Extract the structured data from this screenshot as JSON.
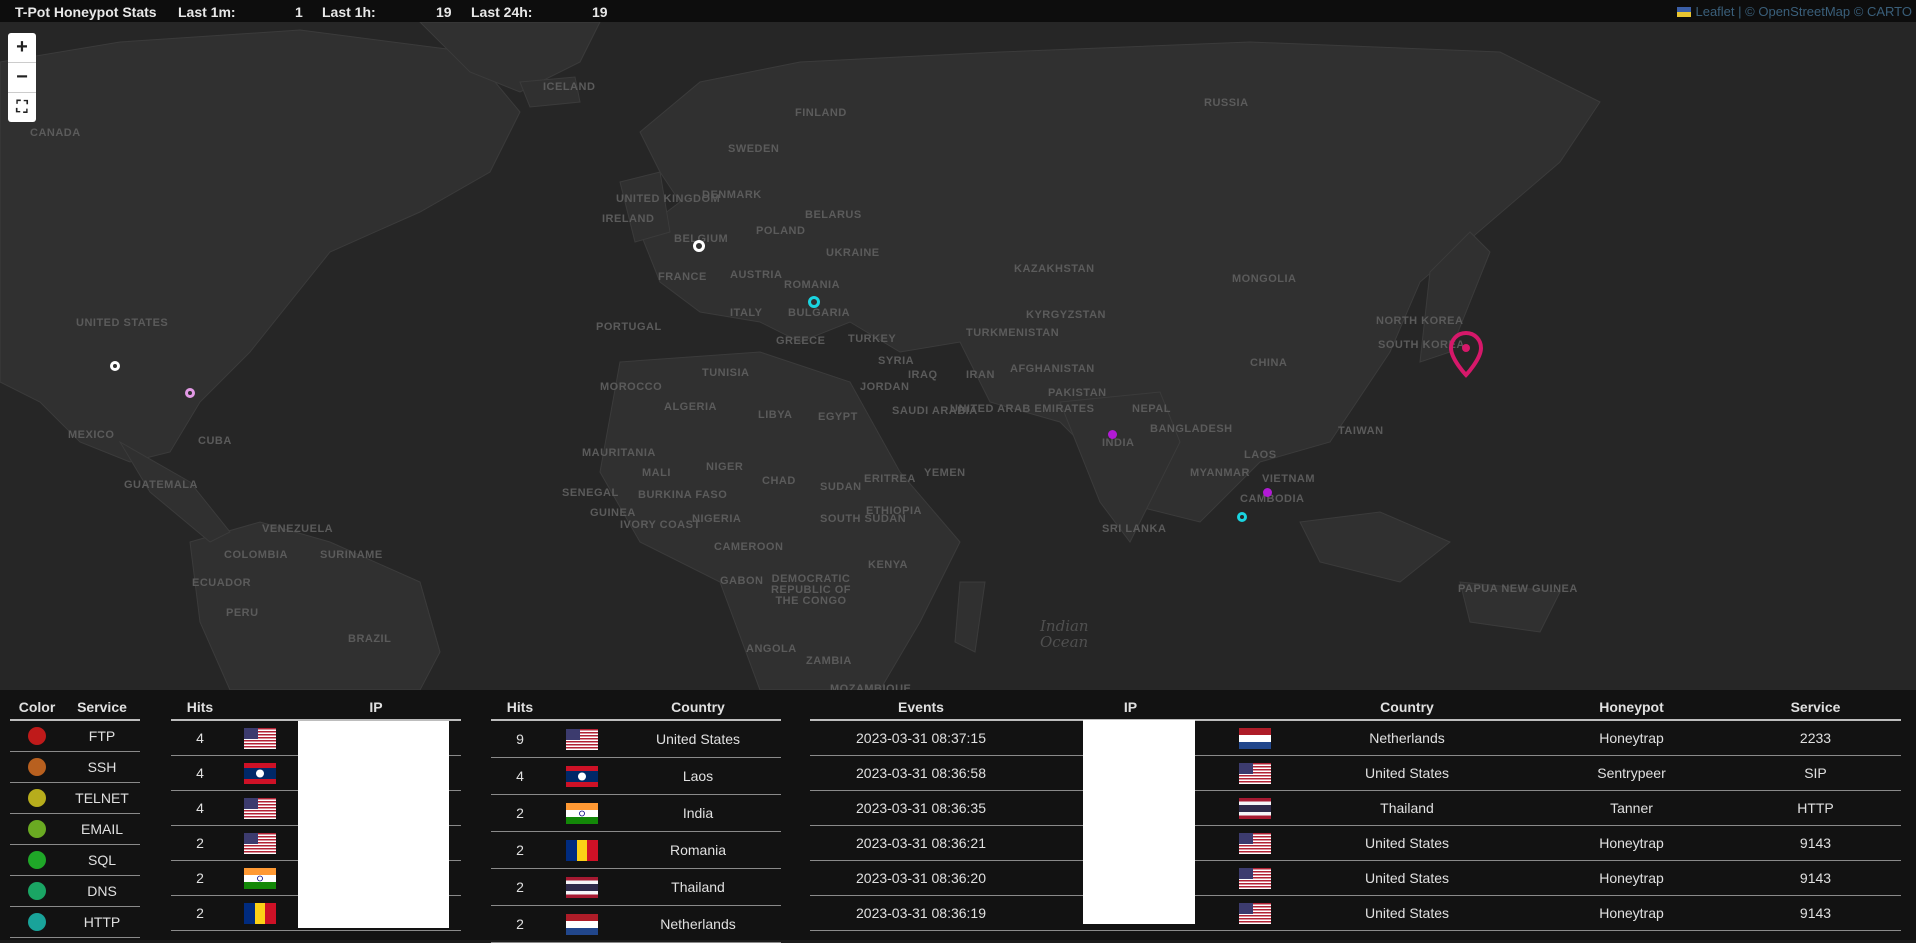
{
  "topbar": {
    "title": "T-Pot Honeypot Stats",
    "last_1m_label": "Last 1m:",
    "last_1m": "1",
    "last_1h_label": "Last 1h:",
    "last_1h": "19",
    "last_24h_label": "Last 24h:",
    "last_24h": "19"
  },
  "attribution": {
    "leaflet": "Leaflet",
    "sep": "|",
    "osm": "© OpenStreetMap",
    "carto": "© CARTO"
  },
  "map_controls": {
    "zoom_in": "+",
    "zoom_out": "−",
    "fullscreen": "⛶"
  },
  "map_labels": [
    "CANADA",
    "UNITED STATES",
    "MEXICO",
    "CUBA",
    "GUATEMALA",
    "VENEZUELA",
    "COLOMBIA",
    "SURINAME",
    "ECUADOR",
    "PERU",
    "BRAZIL",
    "ICELAND",
    "FINLAND",
    "SWEDEN",
    "UNITED KINGDOM",
    "IRELAND",
    "DENMARK",
    "BELGIUM",
    "POLAND",
    "BELARUS",
    "UKRAINE",
    "FRANCE",
    "AUSTRIA",
    "ROMANIA",
    "ITALY",
    "BULGARIA",
    "GREECE",
    "PORTUGAL",
    "TURKEY",
    "RUSSIA",
    "KAZAKHSTAN",
    "MONGOLIA",
    "KYRGYZSTAN",
    "TURKMENISTAN",
    "AFGHANISTAN",
    "IRAN",
    "IRAQ",
    "SYRIA",
    "JORDAN",
    "SAUDI ARABIA",
    "UNITED ARAB EMIRATES",
    "YEMEN",
    "PAKISTAN",
    "NEPAL",
    "INDIA",
    "BANGLADESH",
    "CHINA",
    "NORTH KOREA",
    "SOUTH KOREA",
    "TAIWAN",
    "MYANMAR",
    "LAOS",
    "VIETNAM",
    "CAMBODIA",
    "SRI LANKA",
    "PAPUA NEW GUINEA",
    "MOROCCO",
    "ALGERIA",
    "LIBYA",
    "EGYPT",
    "TUNISIA",
    "MAURITANIA",
    "MALI",
    "NIGER",
    "CHAD",
    "SUDAN",
    "SOUTH SUDAN",
    "ERITREA",
    "ETHIOPIA",
    "KENYA",
    "SENEGAL",
    "GUINEA",
    "BURKINA FASO",
    "IVORY COAST",
    "NIGERIA",
    "CAMEROON",
    "GABON",
    "DEMOCRATIC REPUBLIC OF THE CONGO",
    "ANGOLA",
    "ZAMBIA",
    "MOZAMBIQUE",
    "Indian Ocean"
  ],
  "services_legend": {
    "headers": [
      "Color",
      "Service"
    ],
    "rows": [
      {
        "color": "#bf1a1a",
        "service": "FTP"
      },
      {
        "color": "#b8601f",
        "service": "SSH"
      },
      {
        "color": "#b7ad1c",
        "service": "TELNET"
      },
      {
        "color": "#6aaa22",
        "service": "EMAIL"
      },
      {
        "color": "#1fa728",
        "service": "SQL"
      },
      {
        "color": "#1aa564",
        "service": "DNS"
      },
      {
        "color": "#19a39a",
        "service": "HTTP"
      }
    ]
  },
  "ip_hits": {
    "headers": [
      "Hits",
      "",
      "IP"
    ],
    "rows": [
      {
        "hits": "4",
        "flag": "us"
      },
      {
        "hits": "4",
        "flag": "la"
      },
      {
        "hits": "4",
        "flag": "us"
      },
      {
        "hits": "2",
        "flag": "us"
      },
      {
        "hits": "2",
        "flag": "in"
      },
      {
        "hits": "2",
        "flag": "ro"
      }
    ]
  },
  "country_hits": {
    "headers": [
      "Hits",
      "",
      "Country"
    ],
    "rows": [
      {
        "hits": "9",
        "flag": "us",
        "country": "United States"
      },
      {
        "hits": "4",
        "flag": "la",
        "country": "Laos"
      },
      {
        "hits": "2",
        "flag": "in",
        "country": "India"
      },
      {
        "hits": "2",
        "flag": "ro",
        "country": "Romania"
      },
      {
        "hits": "2",
        "flag": "th",
        "country": "Thailand"
      },
      {
        "hits": "2",
        "flag": "nl",
        "country": "Netherlands"
      }
    ]
  },
  "events": {
    "headers": [
      "Events",
      "IP",
      "",
      "Country",
      "Honeypot",
      "Service"
    ],
    "rows": [
      {
        "time": "2023-03-31 08:37:15",
        "flag": "nl",
        "country": "Netherlands",
        "honeypot": "Honeytrap",
        "service": "2233"
      },
      {
        "time": "2023-03-31 08:36:58",
        "flag": "us",
        "country": "United States",
        "honeypot": "Sentrypeer",
        "service": "SIP"
      },
      {
        "time": "2023-03-31 08:36:35",
        "flag": "th",
        "country": "Thailand",
        "honeypot": "Tanner",
        "service": "HTTP"
      },
      {
        "time": "2023-03-31 08:36:21",
        "flag": "us",
        "country": "United States",
        "honeypot": "Honeytrap",
        "service": "9143"
      },
      {
        "time": "2023-03-31 08:36:20",
        "flag": "us",
        "country": "United States",
        "honeypot": "Honeytrap",
        "service": "9143"
      },
      {
        "time": "2023-03-31 08:36:19",
        "flag": "us",
        "country": "United States",
        "honeypot": "Honeytrap",
        "service": "9143"
      }
    ]
  },
  "colors": {
    "attack_pin": "#d6186a",
    "marker_white": "#ffffff",
    "marker_cyan": "#1ad4e0",
    "marker_purple": "#b21ad6",
    "marker_pink": "#e39ae6"
  }
}
